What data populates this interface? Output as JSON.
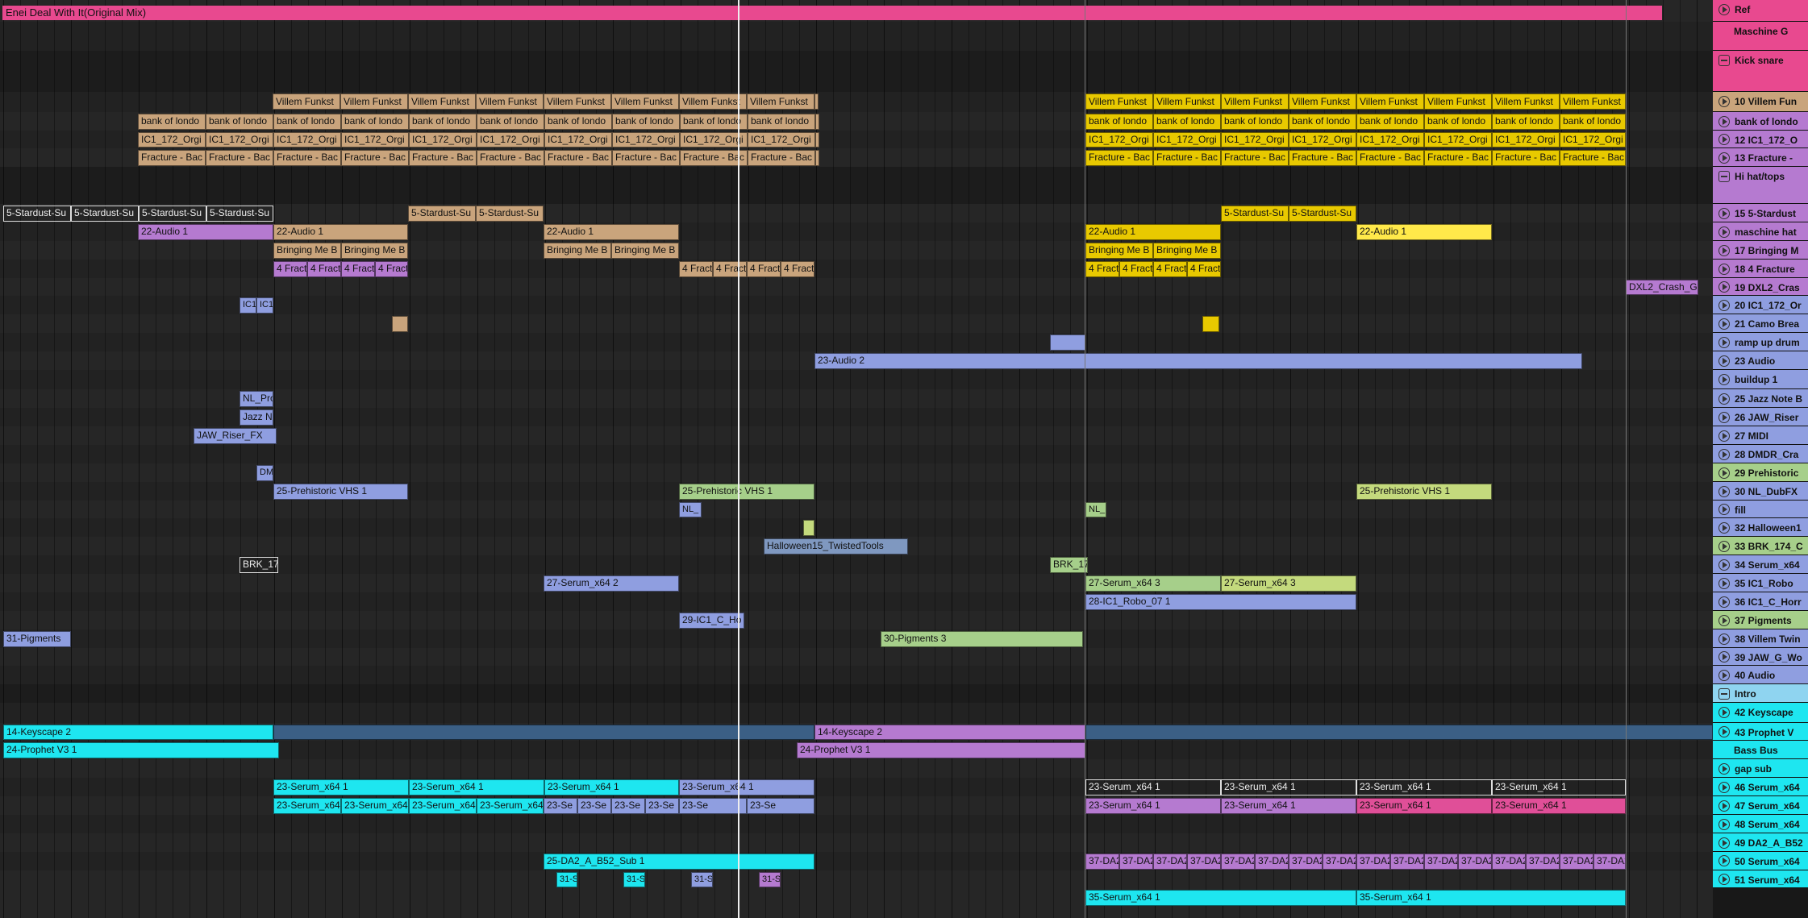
{
  "reference": {
    "label": "Enei Deal With It(Original Mix)"
  },
  "colors": {
    "pink": "#e8498f",
    "purple": "#b57ad0",
    "tan": "#c9a47c",
    "yellow": "#e8c900",
    "cyan": "#1ee6f0",
    "blue": "#8f9ee0",
    "green": "#a6cf8a",
    "slate": "#7f98c0",
    "lime": "#c4da7d",
    "magenta": "#e04f98",
    "violet": "#9b7fe0"
  },
  "tracks": [
    {
      "id": "ref",
      "label": "Ref",
      "color": "#e8498f",
      "kind": "play"
    },
    {
      "id": "maschine-g",
      "label": "Maschine G",
      "color": "#e8498f",
      "kind": "none"
    },
    {
      "id": "kick-snare",
      "label": "Kick snare",
      "color": "#e8498f",
      "kind": "group"
    },
    {
      "id": "t10",
      "label": "10 Villem Fun",
      "color": "#c9a47c",
      "kind": "play"
    },
    {
      "id": "t11",
      "label": "bank of londo",
      "color": "#b57ad0",
      "kind": "play"
    },
    {
      "id": "t12",
      "label": "12 IC1_172_O",
      "color": "#b57ad0",
      "kind": "play"
    },
    {
      "id": "t13",
      "label": "13 Fracture -",
      "color": "#b57ad0",
      "kind": "play"
    },
    {
      "id": "hi-hat",
      "label": "Hi hat/tops",
      "color": "#b57ad0",
      "kind": "group"
    },
    {
      "id": "t15",
      "label": "15 5-Stardust",
      "color": "#b57ad0",
      "kind": "play"
    },
    {
      "id": "t16",
      "label": "maschine hat",
      "color": "#b57ad0",
      "kind": "play"
    },
    {
      "id": "t17",
      "label": "17 Bringing M",
      "color": "#b57ad0",
      "kind": "play"
    },
    {
      "id": "t18",
      "label": "18 4 Fracture",
      "color": "#b57ad0",
      "kind": "play"
    },
    {
      "id": "t19",
      "label": "19 DXL2_Cras",
      "color": "#b57ad0",
      "kind": "play"
    },
    {
      "id": "t20",
      "label": "20 IC1_172_Or",
      "color": "#8f9ee0",
      "kind": "play"
    },
    {
      "id": "t21",
      "label": "21 Camo Brea",
      "color": "#8f9ee0",
      "kind": "play"
    },
    {
      "id": "t22",
      "label": "ramp up drum",
      "color": "#8f9ee0",
      "kind": "play"
    },
    {
      "id": "t23",
      "label": "23 Audio",
      "color": "#8f9ee0",
      "kind": "play"
    },
    {
      "id": "t24",
      "label": "buildup 1",
      "color": "#8f9ee0",
      "kind": "play"
    },
    {
      "id": "t25",
      "label": "25 Jazz Note B",
      "color": "#8f9ee0",
      "kind": "play"
    },
    {
      "id": "t26",
      "label": "26 JAW_Riser",
      "color": "#8f9ee0",
      "kind": "play"
    },
    {
      "id": "t27",
      "label": "27 MIDI",
      "color": "#8f9ee0",
      "kind": "play"
    },
    {
      "id": "t28",
      "label": "28 DMDR_Cra",
      "color": "#8f9ee0",
      "kind": "play"
    },
    {
      "id": "t29",
      "label": "29 Prehistoric",
      "color": "#a6cf8a",
      "kind": "play"
    },
    {
      "id": "t30",
      "label": "30 NL_DubFX",
      "color": "#8f9ee0",
      "kind": "play"
    },
    {
      "id": "t31",
      "label": "fill",
      "color": "#8f9ee0",
      "kind": "play"
    },
    {
      "id": "t32",
      "label": "32 Halloween1",
      "color": "#8f9ee0",
      "kind": "play"
    },
    {
      "id": "t33",
      "label": "33 BRK_174_C",
      "color": "#a6cf8a",
      "kind": "play"
    },
    {
      "id": "t34",
      "label": "34 Serum_x64",
      "color": "#8f9ee0",
      "kind": "play"
    },
    {
      "id": "t35",
      "label": "35 IC1_Robo",
      "color": "#8f9ee0",
      "kind": "play"
    },
    {
      "id": "t36",
      "label": "36 IC1_C_Horr",
      "color": "#8f9ee0",
      "kind": "play"
    },
    {
      "id": "t37",
      "label": "37 Pigments",
      "color": "#a6cf8a",
      "kind": "play"
    },
    {
      "id": "t38",
      "label": "38 Villem Twin",
      "color": "#8f9ee0",
      "kind": "play"
    },
    {
      "id": "t39",
      "label": "39 JAW_G_Wo",
      "color": "#8f9ee0",
      "kind": "play"
    },
    {
      "id": "t40",
      "label": "40 Audio",
      "color": "#8f9ee0",
      "kind": "play"
    },
    {
      "id": "intro",
      "label": "Intro",
      "color": "#8fd4f0",
      "kind": "group"
    },
    {
      "id": "t42",
      "label": "42 Keyscape",
      "color": "#1ee6f0",
      "kind": "play"
    },
    {
      "id": "t43",
      "label": "43 Prophet V",
      "color": "#1ee6f0",
      "kind": "play"
    },
    {
      "id": "bass-bus",
      "label": "Bass Bus",
      "color": "#1ee6f0",
      "kind": "none"
    },
    {
      "id": "gap-sub",
      "label": "gap sub",
      "color": "#1ee6f0",
      "kind": "play"
    },
    {
      "id": "t46",
      "label": "46 Serum_x64",
      "color": "#1ee6f0",
      "kind": "play"
    },
    {
      "id": "t47",
      "label": "47 Serum_x64",
      "color": "#1ee6f0",
      "kind": "play"
    },
    {
      "id": "t48",
      "label": "48 Serum_x64",
      "color": "#1ee6f0",
      "kind": "play"
    },
    {
      "id": "t49",
      "label": "49 DA2_A_B52",
      "color": "#1ee6f0",
      "kind": "play"
    },
    {
      "id": "t50",
      "label": "50 Serum_x64",
      "color": "#1ee6f0",
      "kind": "play"
    },
    {
      "id": "t51",
      "label": "51 Serum_x64",
      "color": "#1ee6f0",
      "kind": "play"
    }
  ],
  "clips": [
    {
      "row": 3,
      "start": 338,
      "end": 1012,
      "label": "Villem Funkst",
      "color": "#c9a47c",
      "repeat": 84
    },
    {
      "row": 3,
      "start": 1346,
      "end": 2016,
      "label": "Villem Funkst",
      "color": "#e8c900",
      "repeat": 84
    },
    {
      "row": 4,
      "start": 171,
      "end": 1012,
      "label": "bank of londo",
      "color": "#c9a47c",
      "repeat": 84
    },
    {
      "row": 4,
      "start": 1346,
      "end": 2016,
      "label": "bank of londo",
      "color": "#e8c900",
      "repeat": 84
    },
    {
      "row": 5,
      "start": 171,
      "end": 1012,
      "label": "IC1_172_Orgi",
      "color": "#c9a47c",
      "repeat": 84
    },
    {
      "row": 5,
      "start": 1346,
      "end": 2016,
      "label": "IC1_172_Orgi",
      "color": "#e8c900",
      "repeat": 84
    },
    {
      "row": 6,
      "start": 171,
      "end": 1012,
      "label": "Fracture - Bac",
      "color": "#c9a47c",
      "repeat": 84
    },
    {
      "row": 6,
      "start": 1346,
      "end": 2016,
      "label": "Fracture - Bac",
      "color": "#e8c900",
      "repeat": 84
    },
    {
      "row": 8,
      "start": 4,
      "end": 339,
      "label": "5-Stardust-Su",
      "color": "#ffffff",
      "repeat": 84,
      "outline": true
    },
    {
      "row": 8,
      "start": 506,
      "end": 674,
      "label": "5-Stardust-Su",
      "color": "#c9a47c",
      "repeat": 84
    },
    {
      "row": 8,
      "start": 1514,
      "end": 1682,
      "label": "5-Stardust-Su",
      "color": "#e8c900",
      "repeat": 84
    },
    {
      "row": 9,
      "start": 171,
      "end": 339,
      "label": "22-Audio 1",
      "color": "#b57ad0"
    },
    {
      "row": 9,
      "start": 339,
      "end": 506,
      "label": "22-Audio 1",
      "color": "#c9a47c"
    },
    {
      "row": 9,
      "start": 674,
      "end": 842,
      "label": "22-Audio 1",
      "color": "#c9a47c"
    },
    {
      "row": 9,
      "start": 1346,
      "end": 1514,
      "label": "22-Audio 1",
      "color": "#e8c900"
    },
    {
      "row": 9,
      "start": 1682,
      "end": 1850,
      "label": "22-Audio 1",
      "color": "#ffe94a"
    },
    {
      "row": 10,
      "start": 339,
      "end": 506,
      "label": "Bringing Me B",
      "color": "#c9a47c",
      "repeat": 84
    },
    {
      "row": 10,
      "start": 674,
      "end": 842,
      "label": "Bringing Me B",
      "color": "#c9a47c",
      "repeat": 84
    },
    {
      "row": 10,
      "start": 1346,
      "end": 1514,
      "label": "Bringing Me B",
      "color": "#e8c900",
      "repeat": 84
    },
    {
      "row": 11,
      "start": 339,
      "end": 506,
      "label": "4 Fract",
      "color": "#b57ad0",
      "repeat": 42
    },
    {
      "row": 11,
      "start": 842,
      "end": 1010,
      "label": "4 Fract",
      "color": "#c9a47c",
      "repeat": 42
    },
    {
      "row": 11,
      "start": 1346,
      "end": 1514,
      "label": "4 Fract",
      "color": "#e8c900",
      "repeat": 42
    },
    {
      "row": 12,
      "start": 2016,
      "end": 2106,
      "label": "DXL2_Crash_G",
      "color": "#b57ad0"
    },
    {
      "row": 13,
      "start": 297,
      "end": 339,
      "label": "IC1",
      "color": "#8f9ee0",
      "repeat": 21
    },
    {
      "row": 14,
      "start": 486,
      "end": 506,
      "label": "",
      "color": "#c9a47c"
    },
    {
      "row": 14,
      "start": 1491,
      "end": 1512,
      "label": "",
      "color": "#e8c900"
    },
    {
      "row": 15,
      "start": 1302,
      "end": 1346,
      "label": "",
      "color": "#8f9ee0"
    },
    {
      "row": 16,
      "start": 1010,
      "end": 1962,
      "label": "23-Audio 2",
      "color": "#8f9ee0"
    },
    {
      "row": 18,
      "start": 297,
      "end": 339,
      "label": "NL_Pro",
      "color": "#8f9ee0"
    },
    {
      "row": 19,
      "start": 297,
      "end": 339,
      "label": "Jazz N",
      "color": "#8f9ee0"
    },
    {
      "row": 20,
      "start": 240,
      "end": 343,
      "label": "JAW_Riser_FX",
      "color": "#8f9ee0"
    },
    {
      "row": 22,
      "start": 318,
      "end": 339,
      "label": "DM",
      "color": "#8f9ee0"
    },
    {
      "row": 23,
      "start": 339,
      "end": 506,
      "label": "25-Prehistoric VHS 1",
      "color": "#8f9ee0"
    },
    {
      "row": 23,
      "start": 842,
      "end": 1010,
      "label": "25-Prehistoric VHS 1",
      "color": "#a6cf8a"
    },
    {
      "row": 23,
      "start": 1682,
      "end": 1850,
      "label": "25-Prehistoric VHS 1",
      "color": "#c4da7d"
    },
    {
      "row": 24,
      "start": 842,
      "end": 870,
      "label": "NL_",
      "color": "#8f9ee0"
    },
    {
      "row": 24,
      "start": 1346,
      "end": 1372,
      "label": "NL_",
      "color": "#a6cf8a"
    },
    {
      "row": 25,
      "start": 996,
      "end": 1010,
      "label": "",
      "color": "#c4da7d"
    },
    {
      "row": 26,
      "start": 947,
      "end": 1126,
      "label": "Halloween15_TwistedTools",
      "color": "#7f98c0"
    },
    {
      "row": 27,
      "start": 297,
      "end": 345,
      "label": "BRK_17",
      "color": "#ffffff",
      "outline": true
    },
    {
      "row": 27,
      "start": 1302,
      "end": 1349,
      "label": "BRK_17",
      "color": "#a6cf8a"
    },
    {
      "row": 28,
      "start": 674,
      "end": 842,
      "label": "27-Serum_x64 2",
      "color": "#8f9ee0"
    },
    {
      "row": 28,
      "start": 1346,
      "end": 1514,
      "label": "27-Serum_x64 3",
      "color": "#a6cf8a"
    },
    {
      "row": 28,
      "start": 1514,
      "end": 1682,
      "label": "27-Serum_x64 3",
      "color": "#c4da7d"
    },
    {
      "row": 29,
      "start": 1346,
      "end": 1682,
      "label": "28-IC1_Robo_07 1",
      "color": "#8f9ee0"
    },
    {
      "row": 30,
      "start": 842,
      "end": 923,
      "label": "29-IC1_C_Ho",
      "color": "#8f9ee0"
    },
    {
      "row": 31,
      "start": 4,
      "end": 88,
      "label": "31-Pigments",
      "color": "#8f9ee0"
    },
    {
      "row": 31,
      "start": 1092,
      "end": 1343,
      "label": "30-Pigments 3",
      "color": "#a6cf8a"
    },
    {
      "row": 36,
      "start": 4,
      "end": 339,
      "label": "14-Keyscape 2",
      "color": "#1ee6f0"
    },
    {
      "row": 36,
      "start": 339,
      "end": 1010,
      "label": "",
      "color": "#3b5f85"
    },
    {
      "row": 36,
      "start": 1010,
      "end": 1346,
      "label": "14-Keyscape 2",
      "color": "#b57ad0"
    },
    {
      "row": 36,
      "start": 1346,
      "end": 2124,
      "label": "",
      "color": "#3b5f85"
    },
    {
      "row": 37,
      "start": 4,
      "end": 346,
      "label": "24-Prophet V3 1",
      "color": "#1ee6f0"
    },
    {
      "row": 37,
      "start": 988,
      "end": 1346,
      "label": "24-Prophet V3 1",
      "color": "#b57ad0"
    },
    {
      "row": 39,
      "start": 339,
      "end": 842,
      "label": "23-Serum_x64 1",
      "color": "#1ee6f0",
      "repeat": 168
    },
    {
      "row": 39,
      "start": 842,
      "end": 1010,
      "label": "23-Serum_x64 1",
      "color": "#8f9ee0"
    },
    {
      "row": 39,
      "start": 1346,
      "end": 2016,
      "label": "23-Serum_x64 1",
      "color": "#ffffff",
      "repeat": 168,
      "outline": true
    },
    {
      "row": 40,
      "start": 339,
      "end": 674,
      "label": "23-Serum_x64 1",
      "color": "#1ee6f0",
      "repeat": 84
    },
    {
      "row": 40,
      "start": 674,
      "end": 842,
      "label": "23-Se",
      "color": "#8f9ee0",
      "repeat": 42
    },
    {
      "row": 40,
      "start": 842,
      "end": 1010,
      "label": "23-Se",
      "color": "#8f9ee0",
      "repeat": 84
    },
    {
      "row": 40,
      "start": 1346,
      "end": 1682,
      "label": "23-Serum_x64 1",
      "color": "#b57ad0",
      "repeat": 168
    },
    {
      "row": 40,
      "start": 1682,
      "end": 2016,
      "label": "23-Serum_x64 1",
      "color": "#e04f98",
      "repeat": 168
    },
    {
      "row": 43,
      "start": 674,
      "end": 1010,
      "label": "25-DA2_A_B52_Sub 1",
      "color": "#1ee6f0"
    },
    {
      "row": 43,
      "start": 1346,
      "end": 2016,
      "label": "37-DA2",
      "color": "#b57ad0",
      "repeat": 42
    },
    {
      "row": 44,
      "start": 690,
      "end": 716,
      "label": "31-S",
      "color": "#1ee6f0"
    },
    {
      "row": 44,
      "start": 773,
      "end": 800,
      "label": "31-S",
      "color": "#1ee6f0"
    },
    {
      "row": 44,
      "start": 857,
      "end": 884,
      "label": "31-S",
      "color": "#8f9ee0"
    },
    {
      "row": 44,
      "start": 941,
      "end": 968,
      "label": "31-S",
      "color": "#b57ad0"
    },
    {
      "row": 45,
      "start": 1346,
      "end": 2016,
      "label": "35-Serum_x64 1",
      "color": "#1ee6f0",
      "repeat": 336
    }
  ],
  "markers": {
    "locators": [
      915
    ],
    "loop_lines": [
      1345,
      2016
    ]
  }
}
